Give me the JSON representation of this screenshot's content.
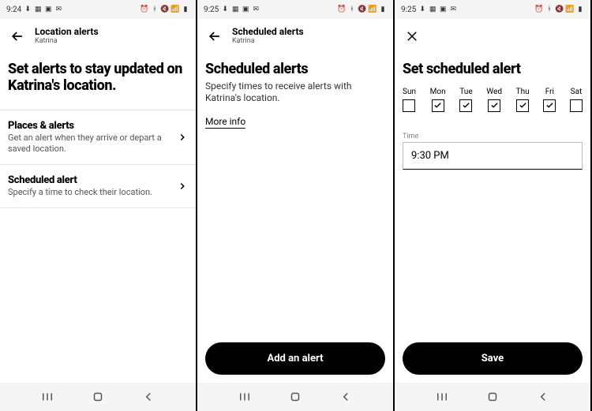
{
  "status": {
    "times": [
      "9:24",
      "9:25",
      "9:25"
    ]
  },
  "screen1": {
    "header": {
      "title": "Location alerts",
      "subtitle": "Katrina"
    },
    "hero": "Set alerts to stay updated on Katrina's location.",
    "rows": [
      {
        "title": "Places & alerts",
        "desc": "Get an alert when they arrive or depart a saved location."
      },
      {
        "title": "Scheduled alert",
        "desc": "Specify a time to check their location."
      }
    ]
  },
  "screen2": {
    "header": {
      "title": "Scheduled alerts",
      "subtitle": "Katrina"
    },
    "hero": "Scheduled alerts",
    "desc": "Specify times to receive alerts with Katrina's location.",
    "more_info": "More info",
    "button": "Add an alert"
  },
  "screen3": {
    "hero": "Set scheduled alert",
    "days": [
      {
        "label": "Sun",
        "checked": false
      },
      {
        "label": "Mon",
        "checked": true
      },
      {
        "label": "Tue",
        "checked": true
      },
      {
        "label": "Wed",
        "checked": true
      },
      {
        "label": "Thu",
        "checked": true
      },
      {
        "label": "Fri",
        "checked": true
      },
      {
        "label": "Sat",
        "checked": false
      }
    ],
    "time_label": "Time",
    "time_value": "9:30 PM",
    "button": "Save"
  }
}
